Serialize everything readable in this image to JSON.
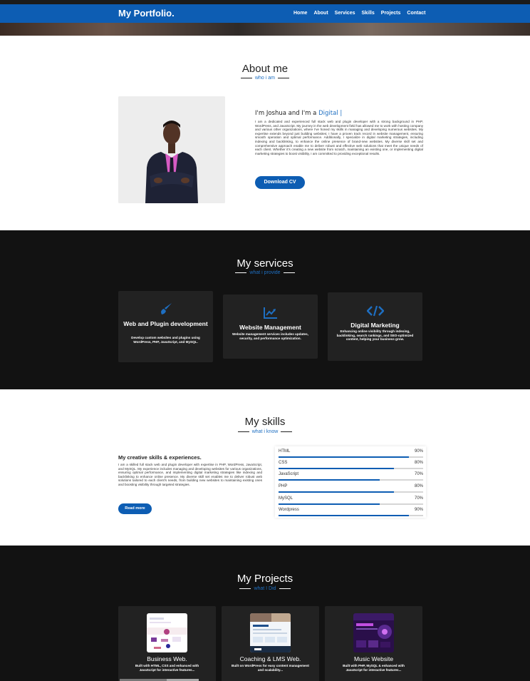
{
  "nav": {
    "brand": "My Portfolio.",
    "links": [
      "Home",
      "About",
      "Services",
      "Skills",
      "Projects",
      "Contact"
    ]
  },
  "about": {
    "title": "About me",
    "subtitle": "who i am",
    "intro_prefix": "I'm Joshua and I'm a ",
    "intro_highlight": "Digital |",
    "text": "I am a dedicated and experienced full stack web and plugin developer with a strong background in PHP, WordPress, and JavaScript. My journey in the web development field has allowed me to work with hosting company and various other organizations, where I've honed my skills in managing and developing numerous websites. My expertise extends beyond just building websites; I have a proven track record in website management, ensuring smooth operation and optimal performance. Additionally, I specialize in digital marketing strategies, including indexing and backlinking, to enhance the online presence of brand-new websites. My diverse skill set and comprehensive approach enable me to deliver robust and effective web solutions that meet the unique needs of each client. Whether it's creating a new website from scratch, maintaining an existing one, or implementing digital marketing strategies to boost visibility, I am committed to providing exceptional results.",
    "button": "Download CV"
  },
  "services": {
    "title": "My services",
    "subtitle": "what i provide",
    "items": [
      {
        "icon": "paint-brush-icon",
        "title": "Web and Plugin development",
        "desc": "Develop custom websites and plugins using WordPress, PHP, JavaScript, and MySQL."
      },
      {
        "icon": "chart-line-icon",
        "title": "Website Management",
        "desc": "Website management services includes updates, security, and performance optimization."
      },
      {
        "icon": "code-icon",
        "title": "Digital Marketing",
        "desc": "Enhancing online visibility through indexing, backlinking, search rankings, and SEO-optimized content, helping your business grow."
      }
    ]
  },
  "skills": {
    "title": "My skills",
    "subtitle": "what i know",
    "heading": "My creative skills & experiences.",
    "text": "I am a skilled full stack web and plugin developer with expertise in PHP, WordPress, JavaScript, and MySQL. My experience includes managing and developing websites for various organizations, ensuring optimal performance, and implementing digital marketing strategies like indexing and backlinking to enhance online presence. My diverse skill set enables me to deliver robust web solutions tailored to each client's needs, from building new websites to maintaining existing ones and boosting visibility through targeted strategies.",
    "button": "Read more",
    "items": [
      {
        "name": "HTML",
        "pct_label": "90%",
        "value": 0.9
      },
      {
        "name": "CSS",
        "pct_label": "80%",
        "value": 0.8
      },
      {
        "name": "JavaScript",
        "pct_label": "70%",
        "value": 0.7
      },
      {
        "name": "PHP",
        "pct_label": "80%",
        "value": 0.8
      },
      {
        "name": "MySQL",
        "pct_label": "70%",
        "value": 0.7
      },
      {
        "name": "Wordpress",
        "pct_label": "90%",
        "value": 0.9
      }
    ]
  },
  "projects": {
    "title": "My Projects",
    "subtitle": "what I Did",
    "items": [
      {
        "title": "Business Web.",
        "desc": "Built with HTML, CSS and enhanced with JavaScript for interactive features..."
      },
      {
        "title": "Coaching & LMS Web.",
        "desc": "Built on WordPress for easy content management and scalability..."
      },
      {
        "title": "Music Website",
        "desc": "Built with PHP, MySQL & enhanced with JavaScript for interactive features..."
      }
    ]
  },
  "colors": {
    "accent": "#0d5db3",
    "dark_bg": "#121212",
    "card_bg": "#222222"
  }
}
